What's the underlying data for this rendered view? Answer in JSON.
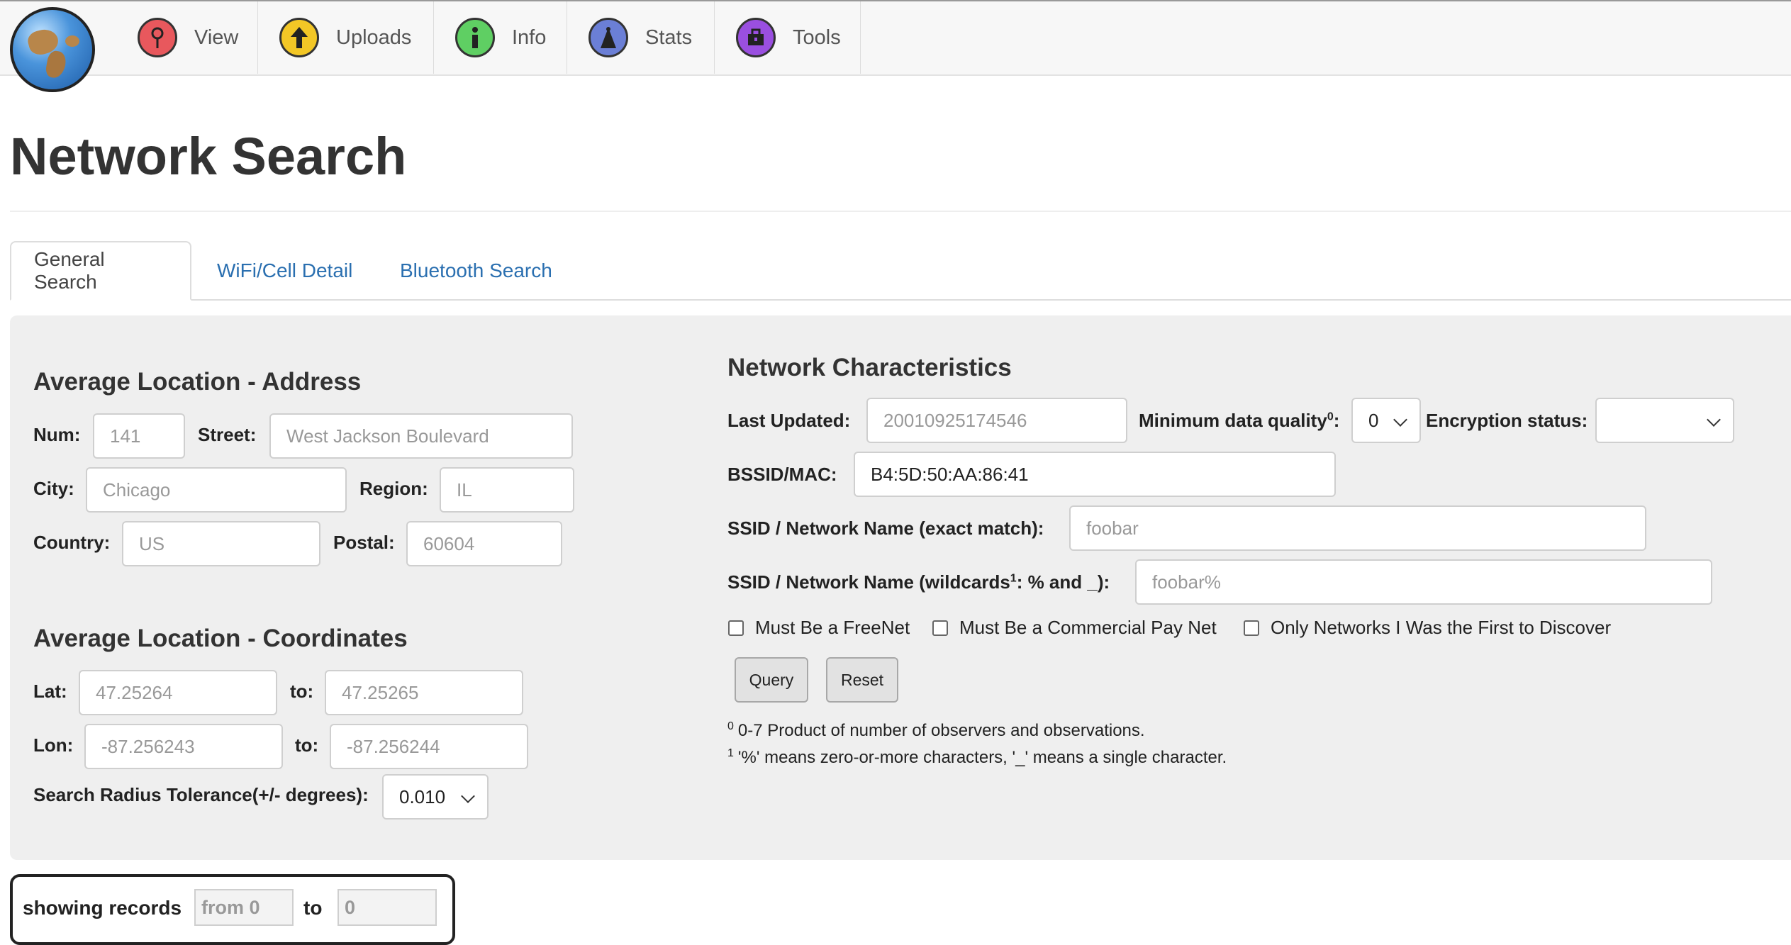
{
  "nav": {
    "items": [
      {
        "label": "View",
        "icon": "signal-pin-icon",
        "color": "#e8585d"
      },
      {
        "label": "Uploads",
        "icon": "upload-arrow-icon",
        "color": "#f3c726"
      },
      {
        "label": "Info",
        "icon": "info-icon",
        "color": "#5fcf63"
      },
      {
        "label": "Stats",
        "icon": "antenna-tower-icon",
        "color": "#6b7fd6"
      },
      {
        "label": "Tools",
        "icon": "toolbox-icon",
        "color": "#9a4fe0"
      }
    ]
  },
  "page_title": "Network Search",
  "tabs": [
    {
      "label": "General Search",
      "active": true
    },
    {
      "label": "WiFi/Cell Detail",
      "active": false
    },
    {
      "label": "Bluetooth Search",
      "active": false
    }
  ],
  "address": {
    "title": "Average Location - Address",
    "num_label": "Num:",
    "num_placeholder": "141",
    "street_label": "Street:",
    "street_placeholder": "West Jackson Boulevard",
    "city_label": "City:",
    "city_placeholder": "Chicago",
    "region_label": "Region:",
    "region_placeholder": "IL",
    "country_label": "Country:",
    "country_placeholder": "US",
    "postal_label": "Postal:",
    "postal_placeholder": "60604"
  },
  "coords": {
    "title": "Average Location - Coordinates",
    "lat_label": "Lat:",
    "lat_from_placeholder": "47.25264",
    "lat_to_label": "to:",
    "lat_to_placeholder": "47.25265",
    "lon_label": "Lon:",
    "lon_from_placeholder": "-87.256243",
    "lon_to_label": "to:",
    "lon_to_placeholder": "-87.256244",
    "radius_label": "Search Radius Tolerance(+/- degrees):",
    "radius_value": "0.010"
  },
  "network": {
    "title": "Network Characteristics",
    "last_updated_label": "Last Updated:",
    "last_updated_placeholder": "20010925174546",
    "min_quality_label": "Minimum data quality",
    "min_quality_sup": "0",
    "min_quality_colon": ":",
    "min_quality_value": "0",
    "encryption_label": "Encryption status:",
    "encryption_value": "",
    "bssid_label": "BSSID/MAC:",
    "bssid_value": "B4:5D:50:AA:86:41",
    "ssid_exact_label": "SSID / Network Name (exact match):",
    "ssid_exact_placeholder": "foobar",
    "ssid_wild_label_pre": "SSID / Network Name (wildcards",
    "ssid_wild_sup": "1",
    "ssid_wild_label_post": ": % and _):",
    "ssid_wild_placeholder": "foobar%",
    "checks": [
      {
        "label": "Must Be a FreeNet",
        "checked": false
      },
      {
        "label": "Must Be a Commercial Pay Net",
        "checked": false
      },
      {
        "label": "Only Networks I Was the First to Discover",
        "checked": false
      }
    ],
    "query_label": "Query",
    "reset_label": "Reset",
    "note0_sup": "0",
    "note0": "0-7 Product of number of observers and observations.",
    "note1_sup": "1",
    "note1": "'%' means zero-or-more characters, '_' means a single character."
  },
  "records": {
    "label": "showing records",
    "from_placeholder": "from 0",
    "to_label": "to",
    "to_placeholder": "0"
  }
}
